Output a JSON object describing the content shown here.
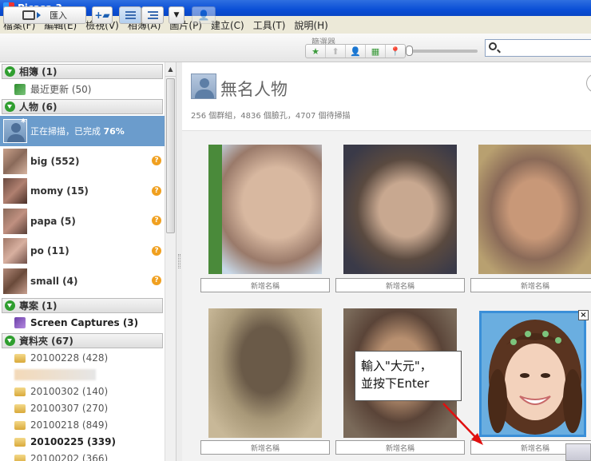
{
  "window": {
    "title": "Picasa 3"
  },
  "menu": [
    "檔案(F)",
    "編輯(E)",
    "檢視(V)",
    "相簿(A)",
    "圖片(P)",
    "建立(C)",
    "工具(T)",
    "說明(H)"
  ],
  "toolbar": {
    "import_label": "匯入",
    "filter_label": "篩選器",
    "filters": [
      "★",
      "⬆",
      "👤",
      "▦",
      "📍"
    ],
    "search_placeholder": ""
  },
  "sidebar": {
    "albums_header": "相簿 (1)",
    "album_item": "最近更新 (50)",
    "people_header": "人物 (6)",
    "scanning_text": "正在掃描，已完成",
    "scanning_percent": "76%",
    "people": [
      {
        "name": "big (552)"
      },
      {
        "name": "momy (15)"
      },
      {
        "name": "papa (5)"
      },
      {
        "name": "po (11)"
      },
      {
        "name": "small (4)"
      }
    ],
    "projects_header": "專案 (1)",
    "project_item": "Screen Captures (3)",
    "folders_header": "資料夾 (67)",
    "folders": [
      {
        "label": "20100228 (428)",
        "bold": false
      },
      {
        "label": "",
        "bold": false,
        "blurred": true
      },
      {
        "label": "20100302 (140)",
        "bold": false
      },
      {
        "label": "20100307 (270)",
        "bold": false
      },
      {
        "label": "20100218 (849)",
        "bold": false
      },
      {
        "label": "20100225 (339)",
        "bold": true
      },
      {
        "label": "20100202 (366)",
        "bold": false
      }
    ]
  },
  "main": {
    "title": "無名人物",
    "stats": "256 個群組，4836 個臉孔，4707 個待掃描",
    "name_placeholder": "新增名稱",
    "callout_line1": "輸入\"大元\"，",
    "callout_line2": "並按下Enter"
  },
  "colors": {
    "title_bar": "#0a4fd6",
    "selected_row": "#6b9ccc",
    "toggle_green": "#2f9e2f",
    "arrow_red": "#e01010",
    "selection_border": "#3a8fd8"
  }
}
